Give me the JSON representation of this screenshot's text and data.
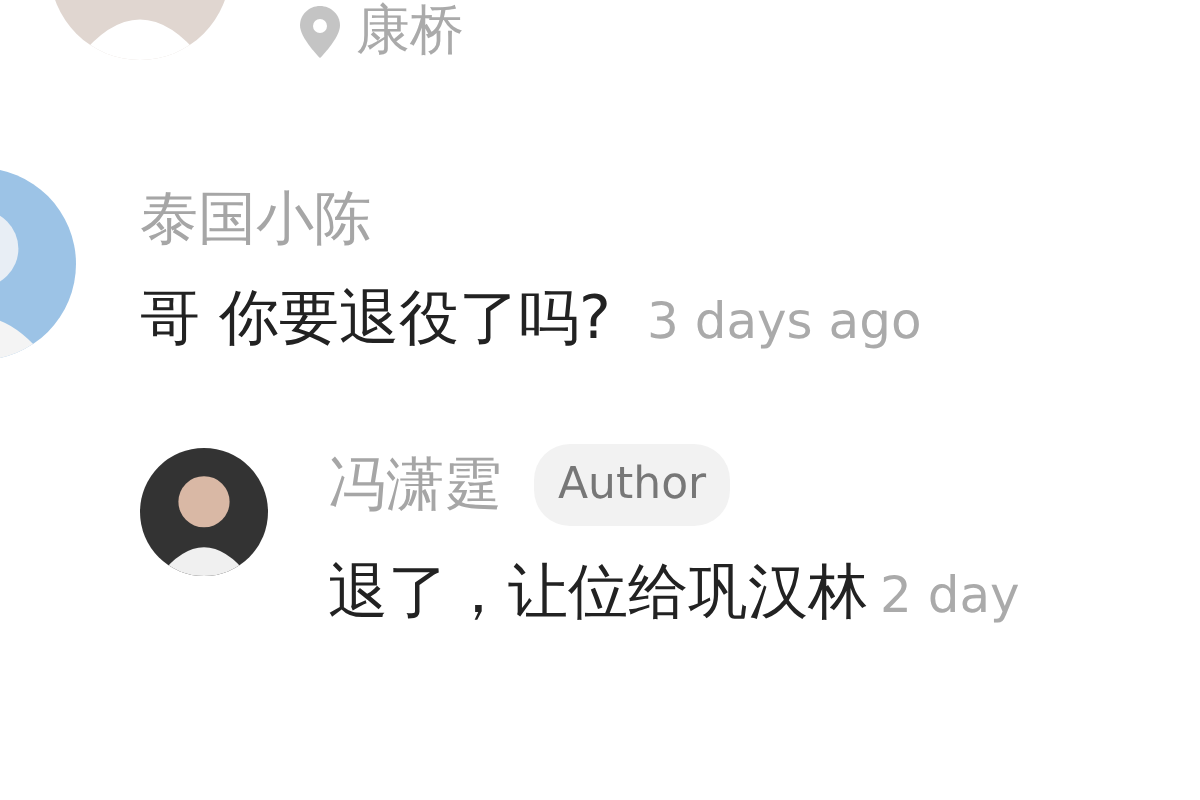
{
  "post_header": {
    "location": "康桥"
  },
  "comments": [
    {
      "author": "泰国小陈",
      "text": "哥 你要退役了吗?",
      "time": "3 days ago",
      "replies": [
        {
          "author": "冯潇霆",
          "badge": "Author",
          "text": "退了，让位给巩汉林",
          "time": "2 day"
        }
      ]
    }
  ]
}
